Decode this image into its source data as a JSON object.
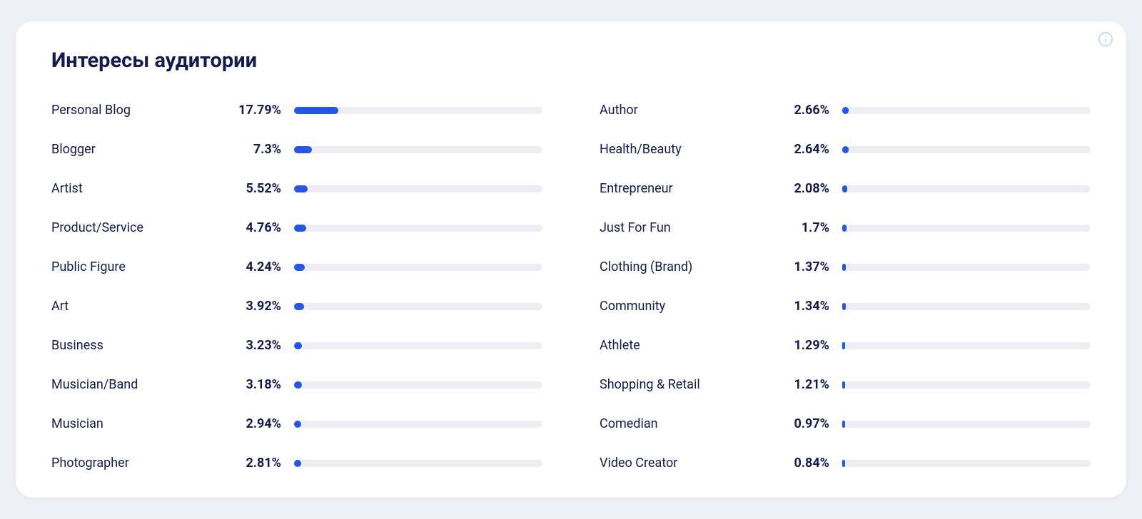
{
  "panel": {
    "title": "Интересы аудитории",
    "info_icon": "info-icon"
  },
  "chart_data": {
    "type": "bar",
    "title": "Интересы аудитории",
    "xlabel": "",
    "ylabel": "",
    "bar_scale_max": 100,
    "categories": [
      "Personal Blog",
      "Blogger",
      "Artist",
      "Product/Service",
      "Public Figure",
      "Art",
      "Business",
      "Musician/Band",
      "Musician",
      "Photographer",
      "Author",
      "Health/Beauty",
      "Entrepreneur",
      "Just For Fun",
      "Clothing (Brand)",
      "Community",
      "Athlete",
      "Shopping & Retail",
      "Comedian",
      "Video Creator"
    ],
    "values": [
      17.79,
      7.3,
      5.52,
      4.76,
      4.24,
      3.92,
      3.23,
      3.18,
      2.94,
      2.81,
      2.66,
      2.64,
      2.08,
      1.7,
      1.37,
      1.34,
      1.29,
      1.21,
      0.97,
      0.84
    ],
    "value_labels": [
      "17.79%",
      "7.3%",
      "5.52%",
      "4.76%",
      "4.24%",
      "3.92%",
      "3.23%",
      "3.18%",
      "2.94%",
      "2.81%",
      "2.66%",
      "2.64%",
      "2.08%",
      "1.7%",
      "1.37%",
      "1.34%",
      "1.29%",
      "1.21%",
      "0.97%",
      "0.84%"
    ]
  },
  "colors": {
    "accent": "#2656e6",
    "track": "#eceef4",
    "text": "#141C4D"
  }
}
